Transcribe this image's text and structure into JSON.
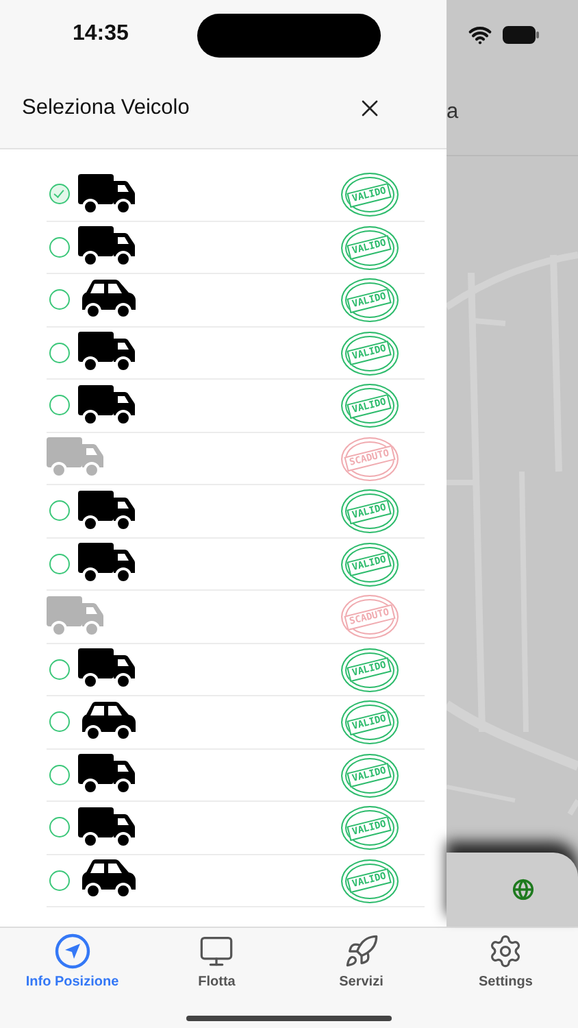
{
  "status_bar": {
    "time": "14:35"
  },
  "drawer": {
    "title": "Seleziona Veicolo",
    "vehicles": [
      {
        "kind": "truck",
        "available": true,
        "selected": true,
        "stamp": "VALIDO"
      },
      {
        "kind": "truck",
        "available": true,
        "selected": false,
        "stamp": "VALIDO"
      },
      {
        "kind": "car",
        "available": true,
        "selected": false,
        "stamp": "VALIDO"
      },
      {
        "kind": "truck",
        "available": true,
        "selected": false,
        "stamp": "VALIDO"
      },
      {
        "kind": "truck",
        "available": true,
        "selected": false,
        "stamp": "VALIDO"
      },
      {
        "kind": "truck",
        "available": false,
        "stamp": "SCADUTO"
      },
      {
        "kind": "truck",
        "available": true,
        "selected": false,
        "stamp": "VALIDO"
      },
      {
        "kind": "truck",
        "available": true,
        "selected": false,
        "stamp": "VALIDO"
      },
      {
        "kind": "truck",
        "available": false,
        "stamp": "SCADUTO"
      },
      {
        "kind": "truck",
        "available": true,
        "selected": false,
        "stamp": "VALIDO"
      },
      {
        "kind": "car",
        "available": true,
        "selected": false,
        "stamp": "VALIDO"
      },
      {
        "kind": "truck",
        "available": true,
        "selected": false,
        "stamp": "VALIDO"
      },
      {
        "kind": "truck",
        "available": true,
        "selected": false,
        "stamp": "VALIDO"
      },
      {
        "kind": "car",
        "available": true,
        "selected": false,
        "stamp": "VALIDO"
      }
    ]
  },
  "background": {
    "title_fragment": "a"
  },
  "tab_bar": {
    "tabs": [
      {
        "label": "Info Posizione",
        "selected": true
      },
      {
        "label": "Flotta",
        "selected": false
      },
      {
        "label": "Servizi",
        "selected": false
      },
      {
        "label": "Settings",
        "selected": false
      }
    ]
  }
}
